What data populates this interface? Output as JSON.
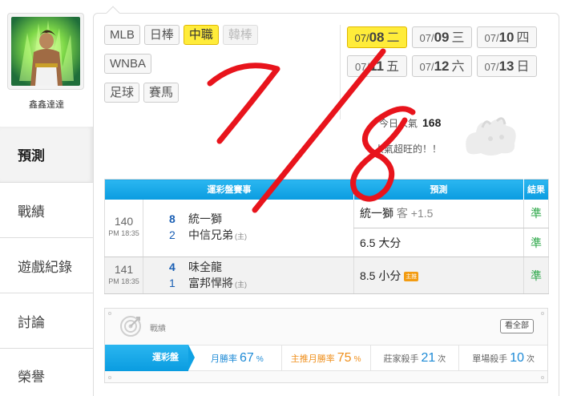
{
  "sidebar": {
    "username": "鑫鑫達達",
    "menu": [
      "預測",
      "戰績",
      "遊戲紀錄",
      "討論",
      "榮譽"
    ]
  },
  "sports": {
    "row1": [
      "MLB",
      "日棒",
      "中職",
      "韓棒"
    ],
    "row2": [
      "WNBA"
    ],
    "row3": [
      "足球",
      "賽馬"
    ],
    "active": "中職",
    "disabled": "韓棒"
  },
  "dates": [
    {
      "mm": "07/",
      "dd": "08",
      "wd": "二",
      "active": true
    },
    {
      "mm": "07/",
      "dd": "09",
      "wd": "三"
    },
    {
      "mm": "07/",
      "dd": "10",
      "wd": "四"
    },
    {
      "mm": "07/",
      "dd": "11",
      "wd": "五"
    },
    {
      "mm": "07/",
      "dd": "12",
      "wd": "六"
    },
    {
      "mm": "07/",
      "dd": "13",
      "wd": "日"
    }
  ],
  "popularity": {
    "label": "今日人氣",
    "value": "168",
    "message": "人氣超旺的！！"
  },
  "table": {
    "headers": [
      "運彩盤賽事",
      "預測",
      "結果"
    ],
    "games": [
      {
        "id": "140",
        "time": "PM 18:35",
        "away_score": "8",
        "away_team": "統一獅",
        "home_score": "2",
        "home_team": "中信兄弟",
        "home_tag": "(主)",
        "picks": [
          {
            "main": "統一獅",
            "sub": "客 +1.5",
            "result": "準"
          },
          {
            "main": "6.5 大分",
            "sub": "",
            "result": "準"
          }
        ]
      },
      {
        "id": "141",
        "time": "PM 18:35",
        "away_score": "4",
        "away_team": "味全龍",
        "home_score": "1",
        "home_team": "富邦悍將",
        "home_tag": "(主)",
        "picks": [
          {
            "main": "8.5 小分",
            "sub": "",
            "badge": "主推",
            "result": "準"
          }
        ]
      }
    ]
  },
  "stats": {
    "title": "戰績",
    "see_all": "看全部",
    "label": "運彩盤",
    "items": [
      {
        "label": "月勝率",
        "value": "67",
        "unit": "%"
      },
      {
        "label": "主推月勝率",
        "value": "75",
        "unit": "%"
      },
      {
        "label": "莊家殺手",
        "value": "21",
        "unit": "次"
      },
      {
        "label": "單場殺手",
        "value": "10",
        "unit": "次"
      }
    ]
  },
  "colors": {
    "accent_blue": "#0a9ce0",
    "active_yellow": "#ffec3a",
    "win_green": "#2ea84a",
    "scribble_red": "#e8141c"
  },
  "overlay": {
    "handwritten": "7/8"
  }
}
